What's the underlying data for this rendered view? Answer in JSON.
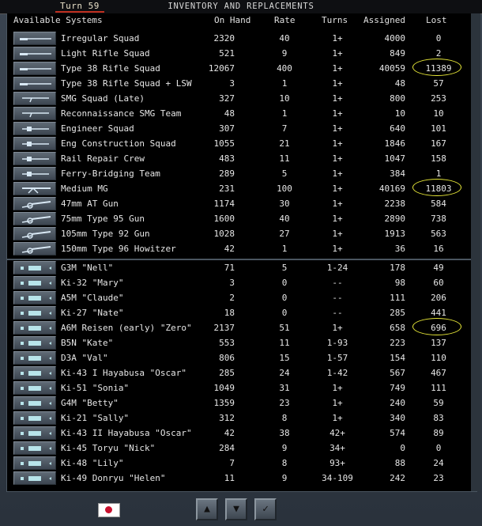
{
  "header": {
    "turn": "Turn 59",
    "title": "INVENTORY AND REPLACEMENTS"
  },
  "columns": {
    "systems": "Available Systems",
    "on_hand": "On Hand",
    "rate": "Rate",
    "turns": "Turns",
    "assigned": "Assigned",
    "lost": "Lost"
  },
  "ground_rows": [
    {
      "name": "Irregular Squad",
      "on_hand": "2320",
      "rate": "40",
      "turns": "1+",
      "assigned": "4000",
      "lost": "0",
      "icon": "rifle-icon"
    },
    {
      "name": "Light Rifle Squad",
      "on_hand": "521",
      "rate": "9",
      "turns": "1+",
      "assigned": "849",
      "lost": "2",
      "icon": "rifle-icon"
    },
    {
      "name": "Type 38 Rifle Squad",
      "on_hand": "12067",
      "rate": "400",
      "turns": "1+",
      "assigned": "40059",
      "lost": "11389",
      "icon": "rifle-icon",
      "highlight": true
    },
    {
      "name": "Type 38 Rifle Squad + LSW",
      "on_hand": "3",
      "rate": "1",
      "turns": "1+",
      "assigned": "48",
      "lost": "57",
      "icon": "rifle-icon"
    },
    {
      "name": "SMG Squad (Late)",
      "on_hand": "327",
      "rate": "10",
      "turns": "1+",
      "assigned": "800",
      "lost": "253",
      "icon": "smg-icon"
    },
    {
      "name": "Reconnaissance SMG Team",
      "on_hand": "48",
      "rate": "1",
      "turns": "1+",
      "assigned": "10",
      "lost": "10",
      "icon": "smg-icon"
    },
    {
      "name": "Engineer Squad",
      "on_hand": "307",
      "rate": "7",
      "turns": "1+",
      "assigned": "640",
      "lost": "101",
      "icon": "engineer-icon"
    },
    {
      "name": "Eng Construction Squad",
      "on_hand": "1055",
      "rate": "21",
      "turns": "1+",
      "assigned": "1846",
      "lost": "167",
      "icon": "engineer-icon"
    },
    {
      "name": "Rail Repair Crew",
      "on_hand": "483",
      "rate": "11",
      "turns": "1+",
      "assigned": "1047",
      "lost": "158",
      "icon": "engineer-icon"
    },
    {
      "name": "Ferry-Bridging Team",
      "on_hand": "289",
      "rate": "5",
      "turns": "1+",
      "assigned": "384",
      "lost": "1",
      "icon": "engineer-icon"
    },
    {
      "name": "Medium MG",
      "on_hand": "231",
      "rate": "100",
      "turns": "1+",
      "assigned": "40169",
      "lost": "11803",
      "icon": "machine-gun-icon",
      "highlight": true
    },
    {
      "name": "47mm AT Gun",
      "on_hand": "1174",
      "rate": "30",
      "turns": "1+",
      "assigned": "2238",
      "lost": "584",
      "icon": "artillery-icon"
    },
    {
      "name": "75mm Type 95 Gun",
      "on_hand": "1600",
      "rate": "40",
      "turns": "1+",
      "assigned": "2890",
      "lost": "738",
      "icon": "artillery-icon"
    },
    {
      "name": "105mm Type 92 Gun",
      "on_hand": "1028",
      "rate": "27",
      "turns": "1+",
      "assigned": "1913",
      "lost": "563",
      "icon": "artillery-icon"
    },
    {
      "name": "150mm Type 96 Howitzer",
      "on_hand": "42",
      "rate": "1",
      "turns": "1+",
      "assigned": "36",
      "lost": "16",
      "icon": "artillery-icon"
    }
  ],
  "air_rows": [
    {
      "name": "G3M \"Nell\"",
      "on_hand": "71",
      "rate": "5",
      "turns": "1-24",
      "assigned": "178",
      "lost": "49",
      "icon": "aircraft-icon"
    },
    {
      "name": "Ki-32 \"Mary\"",
      "on_hand": "3",
      "rate": "0",
      "turns": "--",
      "assigned": "98",
      "lost": "60",
      "icon": "aircraft-icon"
    },
    {
      "name": "A5M \"Claude\"",
      "on_hand": "2",
      "rate": "0",
      "turns": "--",
      "assigned": "111",
      "lost": "206",
      "icon": "aircraft-icon"
    },
    {
      "name": "Ki-27 \"Nate\"",
      "on_hand": "18",
      "rate": "0",
      "turns": "--",
      "assigned": "285",
      "lost": "441",
      "icon": "aircraft-icon"
    },
    {
      "name": "A6M Reisen (early) \"Zero\"",
      "on_hand": "2137",
      "rate": "51",
      "turns": "1+",
      "assigned": "658",
      "lost": "696",
      "icon": "aircraft-icon",
      "highlight": true
    },
    {
      "name": "B5N \"Kate\"",
      "on_hand": "553",
      "rate": "11",
      "turns": "1-93",
      "assigned": "223",
      "lost": "137",
      "icon": "aircraft-icon"
    },
    {
      "name": "D3A \"Val\"",
      "on_hand": "806",
      "rate": "15",
      "turns": "1-57",
      "assigned": "154",
      "lost": "110",
      "icon": "aircraft-icon"
    },
    {
      "name": "Ki-43 I Hayabusa \"Oscar\"",
      "on_hand": "285",
      "rate": "24",
      "turns": "1-42",
      "assigned": "567",
      "lost": "467",
      "icon": "aircraft-icon"
    },
    {
      "name": "Ki-51 \"Sonia\"",
      "on_hand": "1049",
      "rate": "31",
      "turns": "1+",
      "assigned": "749",
      "lost": "111",
      "icon": "aircraft-icon"
    },
    {
      "name": "G4M \"Betty\"",
      "on_hand": "1359",
      "rate": "23",
      "turns": "1+",
      "assigned": "240",
      "lost": "59",
      "icon": "aircraft-icon"
    },
    {
      "name": "Ki-21 \"Sally\"",
      "on_hand": "312",
      "rate": "8",
      "turns": "1+",
      "assigned": "340",
      "lost": "83",
      "icon": "aircraft-icon"
    },
    {
      "name": "Ki-43 II Hayabusa \"Oscar\"",
      "on_hand": "42",
      "rate": "38",
      "turns": "42+",
      "assigned": "574",
      "lost": "89",
      "icon": "aircraft-icon"
    },
    {
      "name": "Ki-45 Toryu \"Nick\"",
      "on_hand": "284",
      "rate": "9",
      "turns": "34+",
      "assigned": "0",
      "lost": "0",
      "icon": "aircraft-icon"
    },
    {
      "name": "Ki-48 \"Lily\"",
      "on_hand": "7",
      "rate": "8",
      "turns": "93+",
      "assigned": "88",
      "lost": "24",
      "icon": "aircraft-icon"
    },
    {
      "name": "Ki-49 Donryu \"Helen\"",
      "on_hand": "11",
      "rate": "9",
      "turns": "34-109",
      "assigned": "242",
      "lost": "23",
      "icon": "aircraft-icon"
    }
  ],
  "footer": {
    "flag": "japan-flag-icon",
    "up_glyph": "▲",
    "down_glyph": "▼",
    "ok_glyph": "✓"
  },
  "colors": {
    "highlight_circle": "#e8e838",
    "flag_red": "#c8102e",
    "turn_underline": "#c03020"
  }
}
